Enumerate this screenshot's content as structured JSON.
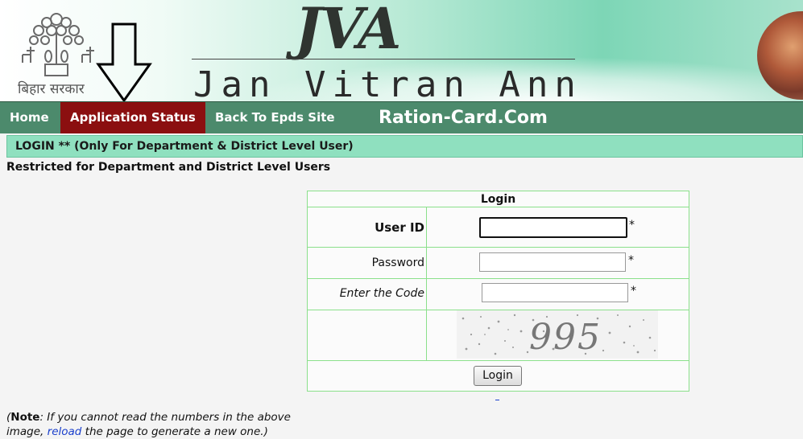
{
  "header": {
    "govt_label": "बिहार सरकार",
    "brand_logo": "JVA",
    "brand_name": "Jan Vitran Ann"
  },
  "nav": {
    "home": "Home",
    "application_status": "Application Status",
    "back_to_epds": "Back To Epds Site",
    "watermark": "Ration-Card.Com"
  },
  "login_section": {
    "heading": "LOGIN ** (Only For Department & District Level User)",
    "restricted_note": "Restricted for Department and District Level Users"
  },
  "login_form": {
    "title": "Login",
    "user_id_label": "User ID",
    "password_label": "Password",
    "code_label": "Enter the Code",
    "required_marker": "*",
    "captcha_text": "995",
    "login_button": "Login"
  },
  "footer_note": {
    "note_label": "Note",
    "text_before_link": ": If you cannot read the numbers in the above image, ",
    "link_text": "reload",
    "text_after_link": " the page to generate a new one.)",
    "open_paren": "("
  },
  "colors": {
    "nav_bg": "#4c8a6c",
    "nav_active_bg": "#8b0f10",
    "login_bar_bg": "#8fe0bf",
    "form_border": "#8be08b",
    "link": "#1a3fcc"
  }
}
